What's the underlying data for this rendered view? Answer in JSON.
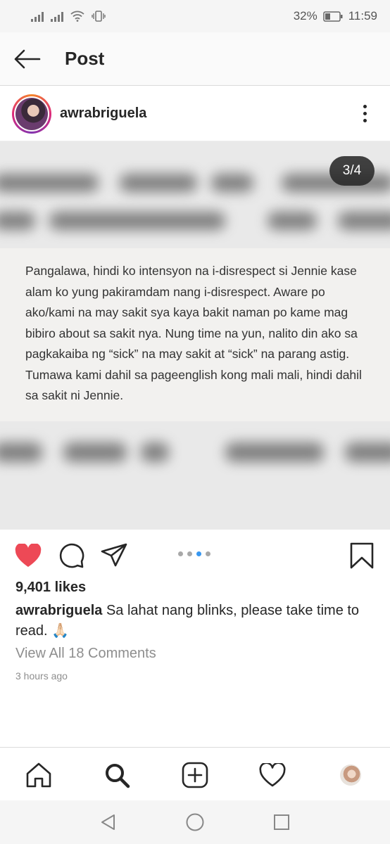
{
  "status_bar": {
    "battery": "32%",
    "time": "11:59"
  },
  "header": {
    "title": "Post",
    "back_icon": "arrow-left-icon"
  },
  "post": {
    "username": "awrabriguela",
    "image_counter": "3/4",
    "image_text": "Pangalawa, hindi ko intensyon na i-disrespect si Jennie kase alam ko yung pakiramdam nang i-disrespect. Aware po ako/kami na may sakit sya kaya bakit naman po kame mag bibiro about sa sakit nya. Nung time na yun, nalito din ako sa pagkakaiba ng “sick” na may sakit at “sick” na parang astig. Tumawa kami dahil sa pageenglish kong mali mali, hindi dahil sa sakit ni Jennie.",
    "carousel": {
      "total": 4,
      "current": 3
    },
    "likes": "9,401 likes",
    "caption_user": "awrabriguela",
    "caption_text": " Sa lahat nang blinks, please take time to read. 🙏🏻",
    "comments_link": "View All 18 Comments",
    "timestamp": "3 hours ago",
    "liked": true
  },
  "colors": {
    "like": "#ed4956",
    "dot_active": "#3897f0",
    "dot_inactive": "#a8a8a8"
  },
  "tab_bar": {
    "items": [
      "home-icon",
      "search-icon",
      "add-post-icon",
      "activity-heart-icon",
      "profile-avatar"
    ]
  },
  "nav_bar": {
    "items": [
      "back-triangle-icon",
      "home-circle-icon",
      "recents-square-icon"
    ]
  }
}
